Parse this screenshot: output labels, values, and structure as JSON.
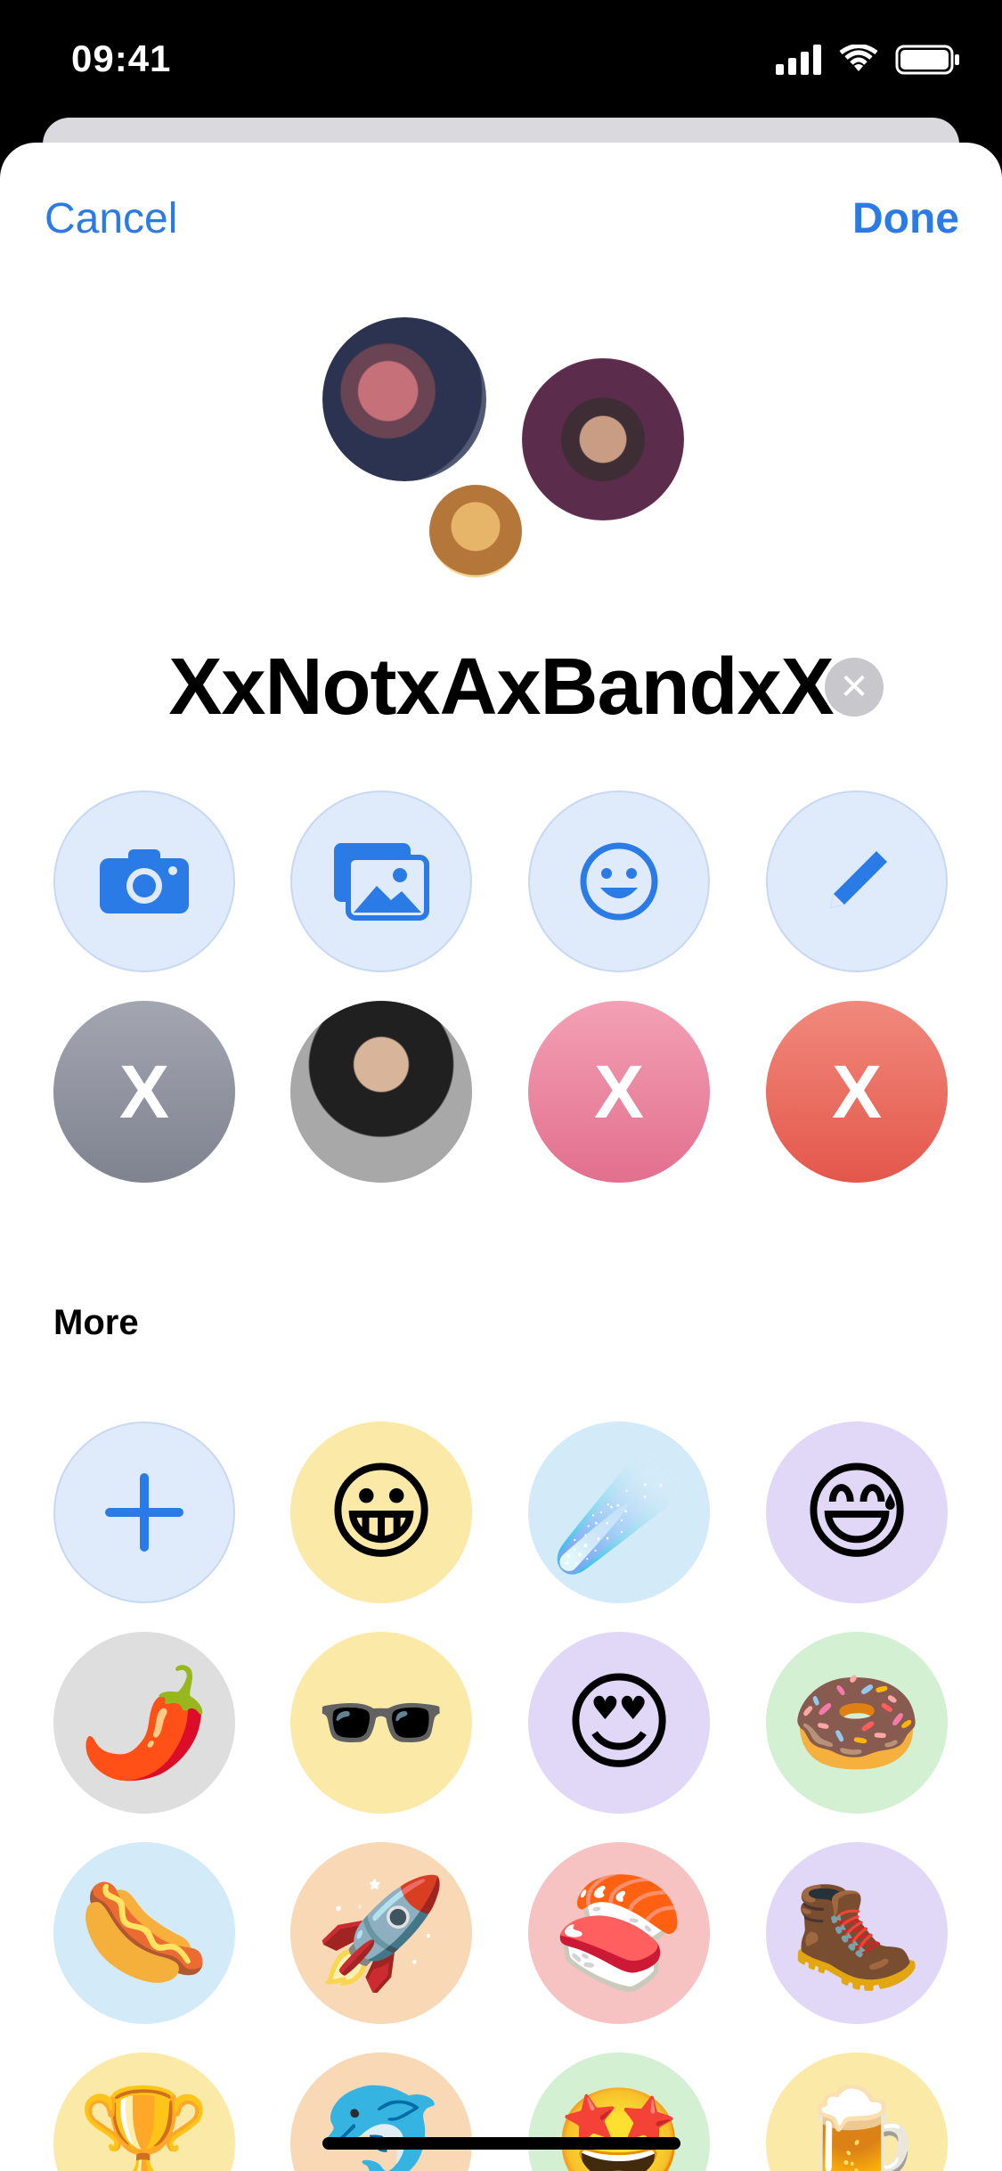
{
  "status": {
    "time": "09:41"
  },
  "nav": {
    "cancel": "Cancel",
    "done": "Done"
  },
  "group": {
    "name": "XxNotxAxBandxX"
  },
  "letters": [
    "X",
    "X",
    "X"
  ],
  "more": {
    "title": "More"
  },
  "emojis": [
    "😀",
    "☄️",
    "😅",
    "🌶️",
    "🕶️",
    "😍",
    "🍩",
    "🌭",
    "🚀",
    "🍣",
    "🥾",
    "🏆",
    "🐬",
    "🤩",
    "🍺"
  ],
  "colors": {
    "accent": "#2b7be6"
  }
}
